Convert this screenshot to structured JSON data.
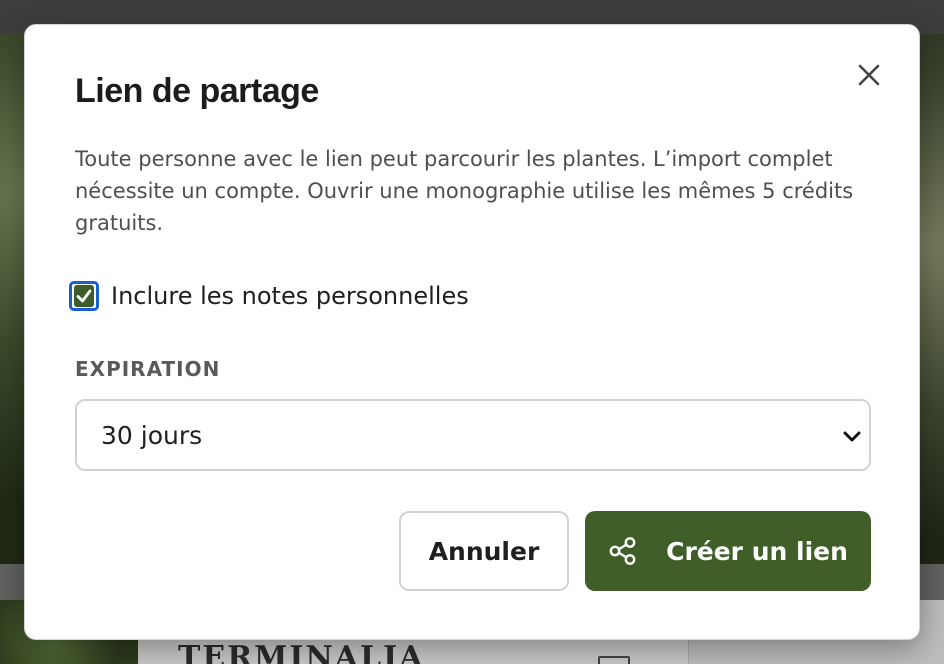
{
  "background": {
    "card_title": "TERMINALIA"
  },
  "dialog": {
    "title": "Lien de partage",
    "description": "Toute personne avec le lien peut parcourir les plantes. L’import complet nécessite un compte. Ouvrir une monographie utilise les mêmes 5 crédits gratuits.",
    "checkbox": {
      "label": "Inclure les notes personnelles",
      "checked": true
    },
    "expiration": {
      "label": "EXPIRATION",
      "selected": "30 jours"
    },
    "buttons": {
      "cancel": "Annuler",
      "create": "Créer un lien"
    },
    "colors": {
      "primary": "#3f5e28",
      "focus_ring": "#1a5fd0"
    },
    "icons": {
      "close": "close-icon",
      "share": "share-icon",
      "chevron": "chevron-down-icon",
      "check": "checkmark-icon"
    }
  }
}
